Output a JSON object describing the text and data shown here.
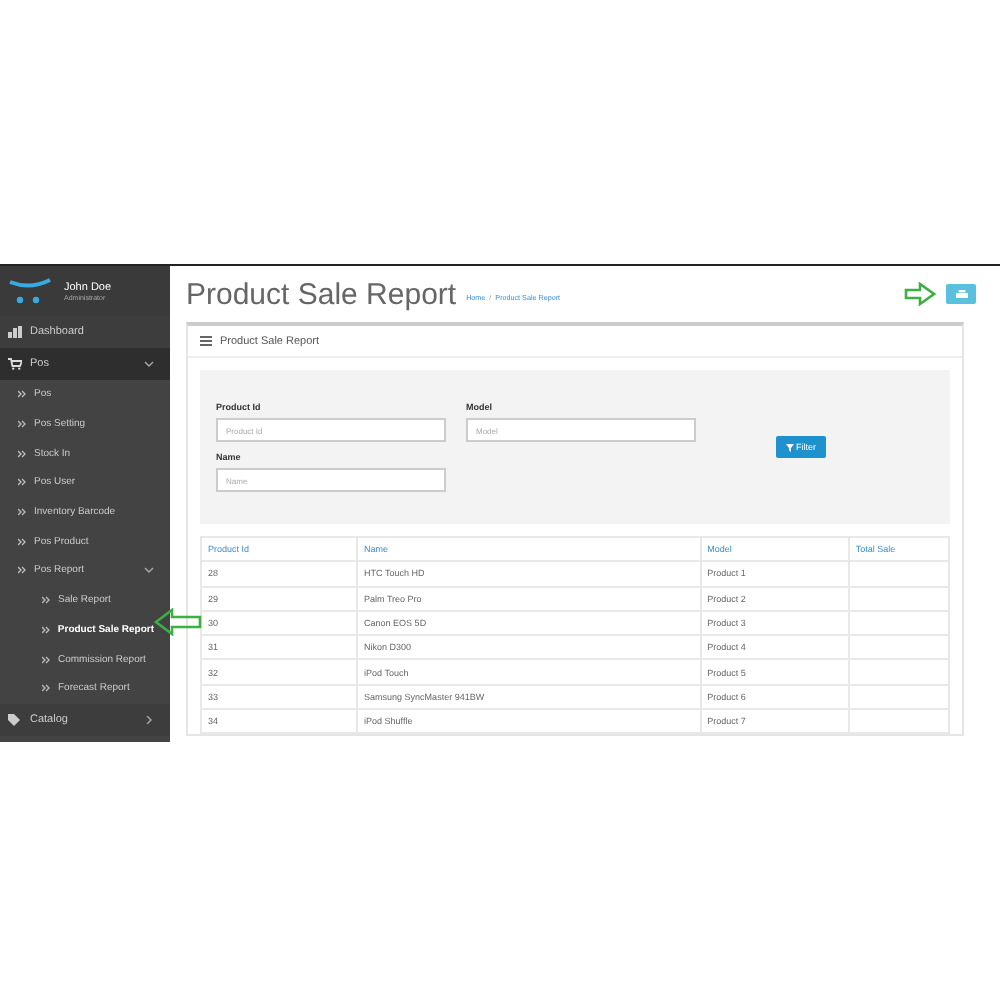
{
  "sidebar": {
    "user": {
      "name": "John Doe",
      "role": "Administrator"
    },
    "items": [
      {
        "label": "Dashboard",
        "selected": false
      },
      {
        "label": "Pos",
        "selected": false,
        "expanded": true,
        "children": [
          {
            "label": "Pos",
            "selected": false
          },
          {
            "label": "Pos Setting",
            "selected": false
          },
          {
            "label": "Stock In",
            "selected": false
          },
          {
            "label": "Pos User",
            "selected": false
          },
          {
            "label": "Inventory Barcode",
            "selected": false
          },
          {
            "label": "Pos Product",
            "selected": false
          },
          {
            "label": "Pos Report",
            "selected": false,
            "expanded": true,
            "children": [
              {
                "label": "Sale Report",
                "selected": false
              },
              {
                "label": "Product Sale Report",
                "selected": true
              },
              {
                "label": "Commission Report",
                "selected": false
              },
              {
                "label": "Forecast Report",
                "selected": false
              }
            ]
          }
        ]
      },
      {
        "label": "Catalog",
        "selected": false,
        "expanded": false
      }
    ]
  },
  "page": {
    "title": "Product Sale Report",
    "breadcrumb": [
      "Home",
      "Product Sale Report"
    ],
    "breadcrumb_separator": "/"
  },
  "panel": {
    "title": "Product Sale Report",
    "filters": [
      {
        "label": "Product Id",
        "placeholder": "Product Id"
      },
      {
        "label": "Model",
        "placeholder": "Model"
      },
      {
        "label": "Name",
        "placeholder": "Name"
      }
    ],
    "filter_button": "Filter"
  },
  "table": {
    "columns": [
      "Product Id",
      "Name",
      "Model",
      "Total Sale"
    ],
    "rows": [
      [
        "28",
        "HTC Touch HD",
        "Product 1"
      ],
      [
        "29",
        "Palm Treo Pro",
        "Product 2"
      ],
      [
        "30",
        "Canon EOS 5D",
        "Product 3"
      ],
      [
        "31",
        "Nikon D300",
        "Product 4"
      ],
      [
        "32",
        "iPod Touch",
        "Product 5"
      ],
      [
        "33",
        "Samsung SyncMaster 941BW",
        "Product 6"
      ],
      [
        "34",
        "iPod Shuffle",
        "Product 7"
      ]
    ]
  }
}
